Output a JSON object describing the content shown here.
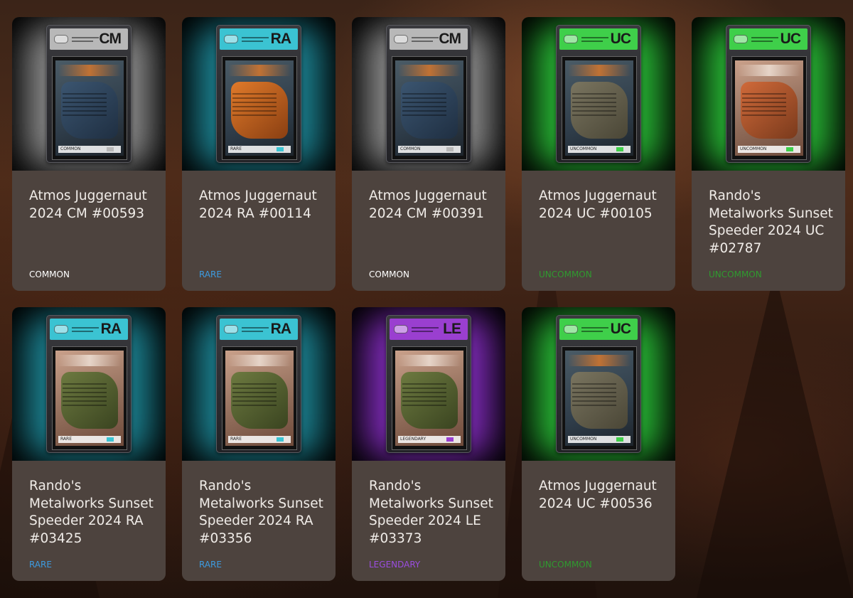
{
  "cards": [
    {
      "name": "Atmos Juggernaut 2024 CM #00593",
      "rarity": "COMMON",
      "code": "CM",
      "rarity_color": "#ffffff",
      "label_color": "#b8b8b8",
      "glow": "#9a9a9a",
      "art": "juggernaut-blue",
      "footer_text": "COMMON"
    },
    {
      "name": "Atmos Juggernaut 2024 RA #00114",
      "rarity": "RARE",
      "code": "RA",
      "rarity_color": "#3d9be0",
      "label_color": "#3bc3d2",
      "glow": "#1f8fa0",
      "art": "juggernaut-orange",
      "footer_text": "RARE"
    },
    {
      "name": "Atmos Juggernaut 2024 CM #00391",
      "rarity": "COMMON",
      "code": "CM",
      "rarity_color": "#ffffff",
      "label_color": "#b8b8b8",
      "glow": "#9a9a9a",
      "art": "juggernaut-blue",
      "footer_text": "COMMON"
    },
    {
      "name": "Atmos Juggernaut 2024 UC #00105",
      "rarity": "UNCOMMON",
      "code": "UC",
      "rarity_color": "#2f9a2f",
      "label_color": "#3fcf4a",
      "glow": "#2cc83a",
      "art": "juggernaut-red",
      "footer_text": "UNCOMMON"
    },
    {
      "name": "Rando's Metalworks Sunset Speeder 2024 UC #02787",
      "rarity": "UNCOMMON",
      "code": "UC",
      "rarity_color": "#2f9a2f",
      "label_color": "#3fcf4a",
      "glow": "#2cc83a",
      "art": "speeder-orange",
      "footer_text": "UNCOMMON"
    },
    {
      "name": "Rando's Metalworks Sunset Speeder 2024 RA #03425",
      "rarity": "RARE",
      "code": "RA",
      "rarity_color": "#3d9be0",
      "label_color": "#3bc3d2",
      "glow": "#1f8fa0",
      "art": "speeder-green",
      "footer_text": "RARE"
    },
    {
      "name": "Rando's Metalworks Sunset Speeder 2024 RA #03356",
      "rarity": "RARE",
      "code": "RA",
      "rarity_color": "#3d9be0",
      "label_color": "#3bc3d2",
      "glow": "#1f8fa0",
      "art": "speeder-green",
      "footer_text": "RARE"
    },
    {
      "name": "Rando's Metalworks Sunset Speeder 2024 LE #03373",
      "rarity": "LEGENDARY",
      "code": "LE",
      "rarity_color": "#9b4de0",
      "label_color": "#9a3fd0",
      "glow": "#8a2fc8",
      "art": "speeder-green",
      "footer_text": "LEGENDARY"
    },
    {
      "name": "Atmos Juggernaut 2024 UC #00536",
      "rarity": "UNCOMMON",
      "code": "UC",
      "rarity_color": "#2f9a2f",
      "label_color": "#3fcf4a",
      "glow": "#2cc83a",
      "art": "juggernaut-red",
      "footer_text": "UNCOMMON"
    }
  ]
}
